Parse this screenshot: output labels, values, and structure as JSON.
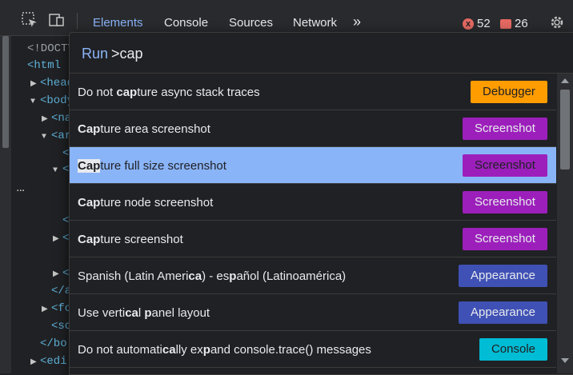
{
  "toolbar": {
    "tabs": [
      "Elements",
      "Console",
      "Sources",
      "Network"
    ],
    "more_label": "»",
    "errors": "52",
    "warnings": "26",
    "error_icon": "x"
  },
  "tree": {
    "lines": [
      "<!DOCTY",
      "<html l",
      "<head",
      "<body",
      "<na",
      "<ar",
      "<",
      "<",
      "",
      "<",
      "<",
      "<",
      "</a",
      "<fo",
      "<sc",
      "</bo",
      "<edi"
    ],
    "dots": "..."
  },
  "palette": {
    "run_label": "Run",
    "query": ">cap",
    "items": [
      {
        "parts": [
          [
            "Do not ",
            false
          ],
          [
            "cap",
            true
          ],
          [
            "ture async stack traces",
            false
          ]
        ],
        "badge": "Debugger",
        "kind": "debugger"
      },
      {
        "parts": [
          [
            "Cap",
            true
          ],
          [
            "ture area screenshot",
            false
          ]
        ],
        "badge": "Screenshot",
        "kind": "screenshot"
      },
      {
        "parts": [
          [
            "Cap",
            true
          ],
          [
            "ture full size screenshot",
            false
          ]
        ],
        "badge": "Screenshot",
        "kind": "screenshot",
        "selected": true
      },
      {
        "parts": [
          [
            "Cap",
            true
          ],
          [
            "ture node screenshot",
            false
          ]
        ],
        "badge": "Screenshot",
        "kind": "screenshot"
      },
      {
        "parts": [
          [
            "Cap",
            true
          ],
          [
            "ture screenshot",
            false
          ]
        ],
        "badge": "Screenshot",
        "kind": "screenshot"
      },
      {
        "parts": [
          [
            "Spanish (Latin Ameri",
            false
          ],
          [
            "ca",
            true
          ],
          [
            ") - es",
            false
          ],
          [
            "p",
            true
          ],
          [
            "añol (Latinoamérica)",
            false
          ]
        ],
        "badge": "Appearance",
        "kind": "appearance"
      },
      {
        "parts": [
          [
            "Use verti",
            false
          ],
          [
            "ca",
            true
          ],
          [
            "l ",
            false
          ],
          [
            "p",
            true
          ],
          [
            "anel layout",
            false
          ]
        ],
        "badge": "Appearance",
        "kind": "appearance"
      },
      {
        "parts": [
          [
            "Do not automati",
            false
          ],
          [
            "ca",
            true
          ],
          [
            "lly ex",
            false
          ],
          [
            "p",
            true
          ],
          [
            "and console.trace() messages",
            false
          ]
        ],
        "badge": "Console",
        "kind": "console"
      }
    ]
  },
  "icons": [
    "inspect-element-icon",
    "device-toolbar-icon",
    "more-tabs-icon",
    "error-icon",
    "warning-flag-icon",
    "settings-gear-icon",
    "scroll-up-icon",
    "scroll-down-icon"
  ]
}
